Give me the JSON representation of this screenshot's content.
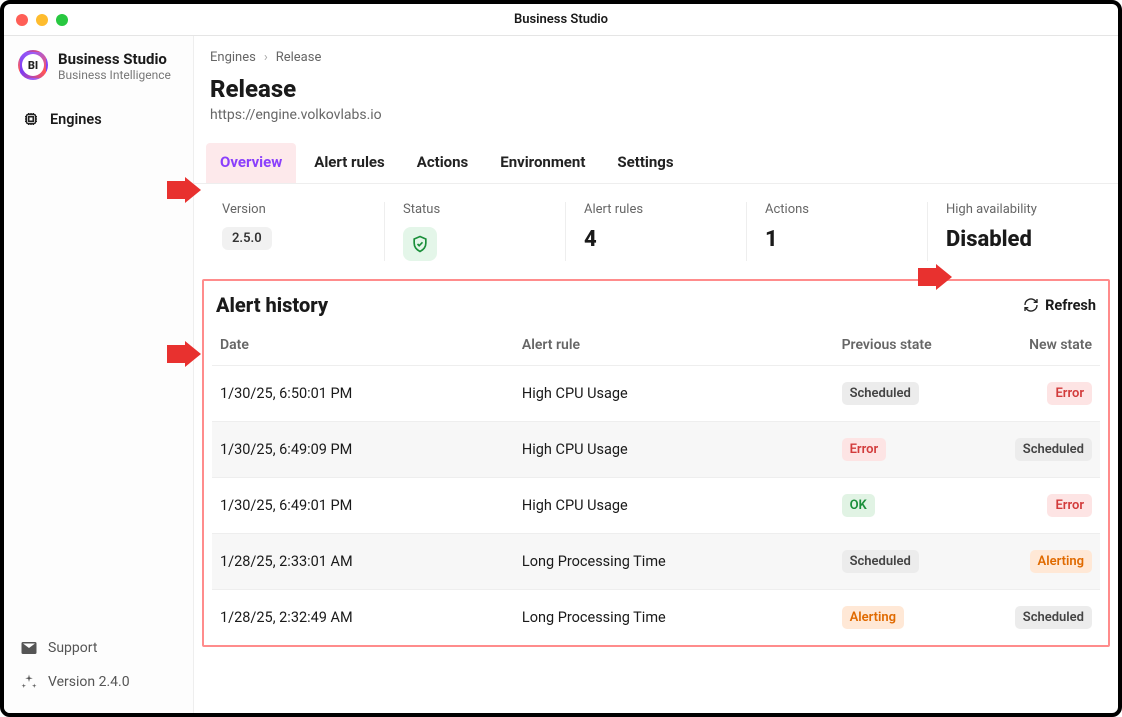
{
  "window": {
    "title": "Business Studio"
  },
  "brand": {
    "title": "Business Studio",
    "subtitle": "Business Intelligence"
  },
  "nav": {
    "engines": "Engines"
  },
  "sidebar_footer": {
    "support": "Support",
    "version": "Version 2.4.0"
  },
  "breadcrumbs": {
    "root": "Engines",
    "leaf": "Release"
  },
  "page": {
    "title": "Release",
    "url": "https://engine.volkovlabs.io"
  },
  "tabs": {
    "overview": "Overview",
    "alert_rules": "Alert rules",
    "actions": "Actions",
    "environment": "Environment",
    "settings": "Settings"
  },
  "stats": {
    "version_label": "Version",
    "version_value": "2.5.0",
    "status_label": "Status",
    "alert_rules_label": "Alert rules",
    "alert_rules_value": "4",
    "actions_label": "Actions",
    "actions_value": "1",
    "ha_label": "High availability",
    "ha_value": "Disabled"
  },
  "history": {
    "title": "Alert history",
    "refresh": "Refresh",
    "cols": {
      "date": "Date",
      "rule": "Alert rule",
      "prev": "Previous state",
      "new": "New state"
    },
    "rows": [
      {
        "date": "1/30/25, 6:50:01 PM",
        "rule": "High CPU Usage",
        "prev": "Scheduled",
        "prev_k": "scheduled",
        "new": "Error",
        "new_k": "error"
      },
      {
        "date": "1/30/25, 6:49:09 PM",
        "rule": "High CPU Usage",
        "prev": "Error",
        "prev_k": "error",
        "new": "Scheduled",
        "new_k": "scheduled"
      },
      {
        "date": "1/30/25, 6:49:01 PM",
        "rule": "High CPU Usage",
        "prev": "OK",
        "prev_k": "ok",
        "new": "Error",
        "new_k": "error"
      },
      {
        "date": "1/28/25, 2:33:01 AM",
        "rule": "Long Processing Time",
        "prev": "Scheduled",
        "prev_k": "scheduled",
        "new": "Alerting",
        "new_k": "alerting"
      },
      {
        "date": "1/28/25, 2:32:49 AM",
        "rule": "Long Processing Time",
        "prev": "Alerting",
        "prev_k": "alerting",
        "new": "Scheduled",
        "new_k": "scheduled"
      }
    ]
  }
}
